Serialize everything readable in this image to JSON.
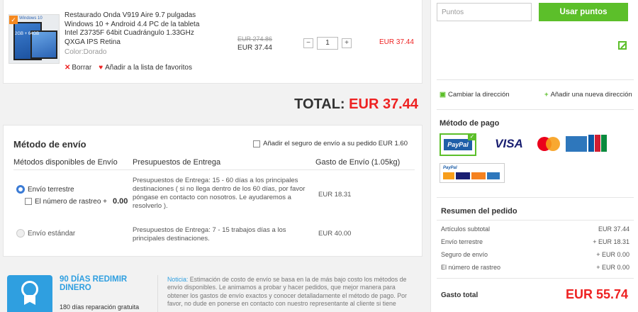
{
  "cart": {
    "item": {
      "title": "Restaurado Onda V919 Aire 9.7 pulgadas Windows 10 + Android 4.4 PC de la tableta Intel Z3735F 64bit Cuadrángulo 1.33GHz QXGA IPS Retina",
      "thumb_label": "Windows 10",
      "thumb_spec": "2GB + 64GB",
      "color": "Color:Dorado",
      "old_price": "EUR 274.86",
      "price": "EUR 37.44",
      "quantity": "1",
      "line_total": "EUR 37.44",
      "delete_label": "Borrar",
      "favorite_label": "Añadir a la lista de favoritos"
    },
    "total_label": "TOTAL:",
    "total_amount": "EUR 37.44"
  },
  "shipping": {
    "title": "Método de envío",
    "insurance_label": "Añadir el seguro de envío a su pedido EUR 1.60",
    "headers": {
      "methods": "Métodos disponibles de Envío",
      "budget": "Presupuestos de Entrega",
      "cost": "Gasto de Envío (1.05kg)"
    },
    "options": [
      {
        "name": "Envío terrestre",
        "budget": "Presupuestos de Entrega: 15 - 60 días a los principales destinaciones ( si no llega dentro de los 60 días, por favor póngase en contacto con nosotros. Le ayudaremos a resolverlo ).",
        "cost": "EUR 18.31",
        "tracking_label": "El número de rastreo +",
        "tracking_value": "0.00"
      },
      {
        "name": "Envío estándar",
        "budget": "Presupuestos de Entrega: 7 - 15 trabajos días a los principales destinaciones.",
        "cost": "EUR 40.00"
      }
    ]
  },
  "guarantee": {
    "title": "90 DÍAS REDIMIR DINERO",
    "subtitle": "180 días reparación gratuita"
  },
  "notice": {
    "label": "Noticia:",
    "text": " Estimación de costo de envío se basa en la de más bajo costo los métodos de envío disponibles. Le animamos a probar y hacer pedidos, que mejor manera para obtener los gastos de envío exactos y conocer detalladamente el método de pago. Por favor, no dude en ponerse en contacto con nuestro representante al cliente si tiene"
  },
  "sidebar": {
    "points_placeholder": "Puntos",
    "points_button": "Usar puntos",
    "change_address": "Cambiar la dirección",
    "new_address": "Añadir una nueva dirección",
    "payment_title": "Método de pago",
    "payment_cards": [
      "PayPal",
      "VISA",
      "Mastercard",
      "American Express",
      "JCB"
    ],
    "summary_title": "Resumen del pedido",
    "summary_rows": [
      {
        "label": "Artículos subtotal",
        "value": "EUR 37.44"
      },
      {
        "label": "Envío terrestre",
        "value": "+ EUR 18.31"
      },
      {
        "label": "Seguro de envío",
        "value": "+ EUR 0.00"
      },
      {
        "label": "El número de rastreo",
        "value": "+ EUR 0.00"
      }
    ],
    "grand_total_label": "Gasto total",
    "grand_total_value": "EUR 55.74"
  },
  "colors": {
    "accent_green": "#5cbf2a",
    "price_red": "#ee2222",
    "link_blue": "#2f9fe0"
  }
}
